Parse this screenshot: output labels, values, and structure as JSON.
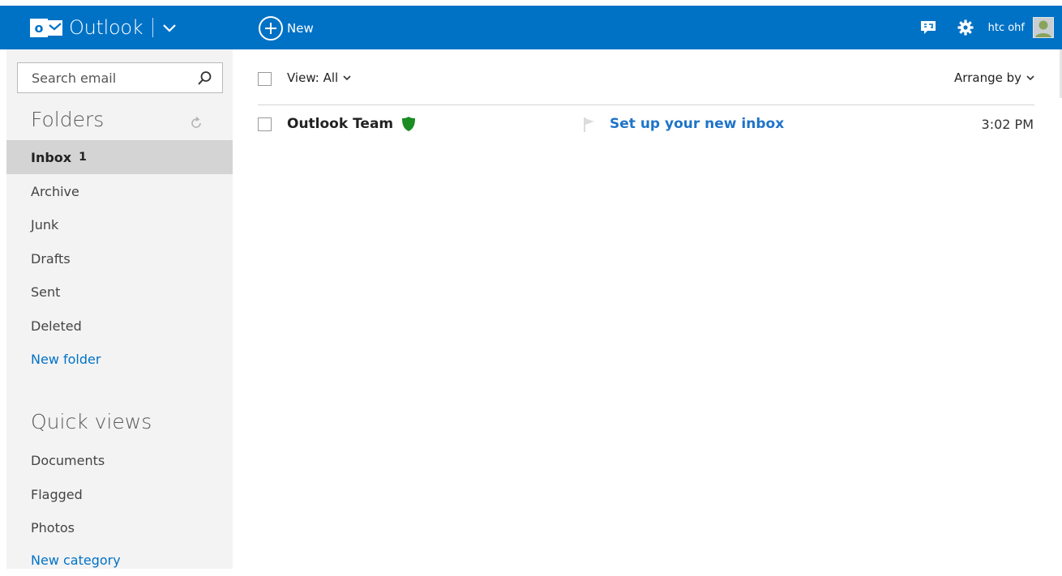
{
  "colors": {
    "accent": "#0072c6",
    "link": "#1f74c9",
    "safe_sender": "#1a8c22",
    "sidebar_bg": "#f3f3f3",
    "selected_bg": "#d4d4d4"
  },
  "header": {
    "app_name": "Outlook",
    "logo_letter": "o",
    "new_label": "New",
    "icons": [
      "feedback-icon",
      "gear-icon"
    ],
    "user_name": "htc ohf"
  },
  "sidebar": {
    "search_placeholder": "Search email",
    "folders_title": "Folders",
    "folders": [
      {
        "label": "Inbox",
        "count": "1",
        "selected": true
      },
      {
        "label": "Archive"
      },
      {
        "label": "Junk"
      },
      {
        "label": "Drafts"
      },
      {
        "label": "Sent"
      },
      {
        "label": "Deleted"
      }
    ],
    "new_folder": "New folder",
    "quick_views_title": "Quick views",
    "quick_views": [
      {
        "label": "Documents"
      },
      {
        "label": "Flagged"
      },
      {
        "label": "Photos"
      }
    ],
    "new_category": "New category"
  },
  "main": {
    "view_label": "View: All",
    "arrange_label": "Arrange by",
    "messages": [
      {
        "sender": "Outlook Team",
        "subject": "Set up your new inbox",
        "time": "3:02 PM",
        "unread": true,
        "safe_sender": true
      }
    ]
  }
}
